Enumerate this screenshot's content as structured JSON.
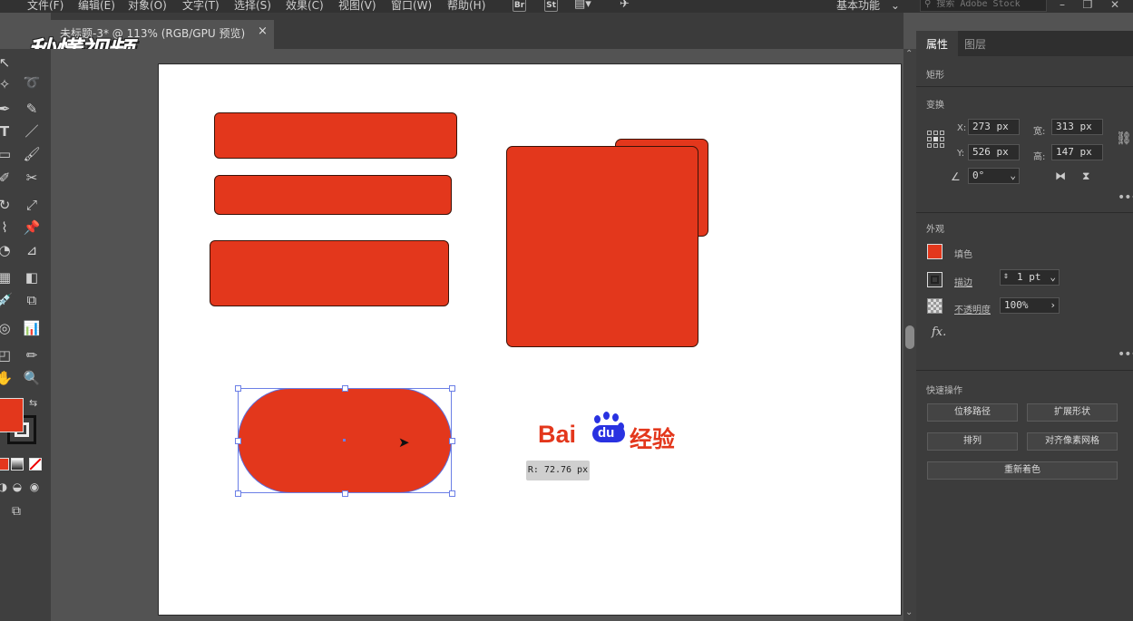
{
  "menubar": {
    "items": [
      "文件(F)",
      "编辑(E)",
      "对象(O)",
      "文字(T)",
      "选择(S)",
      "效果(C)",
      "视图(V)",
      "窗口(W)",
      "帮助(H)"
    ],
    "bridge_label": "Br",
    "stock_label": "St",
    "workspace": "基本功能",
    "search_placeholder": "搜索 Adobe Stock"
  },
  "document_tab": {
    "title": "未标题-3* @ 113% (RGB/GPU 预览)",
    "close": "×"
  },
  "watermark": "秒懂视频",
  "canvas": {
    "radius_tooltip": "R: 72.76 px",
    "logo": {
      "bai": "Bai",
      "du": "du",
      "suffix": "经验"
    }
  },
  "panel": {
    "tabs": [
      "属性",
      "图层"
    ],
    "active_tab": "属性",
    "object_type": "矩形",
    "transform": {
      "title": "变换",
      "x_label": "X:",
      "x": "273 px",
      "y_label": "Y:",
      "y": "526 px",
      "w_label": "宽:",
      "w": "313 px",
      "h_label": "高:",
      "h": "147 px",
      "angle": "0°"
    },
    "appearance": {
      "title": "外观",
      "fill_label": "填色",
      "fill_color": "#e3371c",
      "stroke_label": "描边",
      "stroke_value": "1 pt",
      "opacity_label": "不透明度",
      "opacity_value": "100%",
      "fx": "fx."
    },
    "quick_actions": {
      "title": "快速操作",
      "offset_path": "位移路径",
      "expand_shape": "扩展形状",
      "arrange": "排列",
      "align_pixel": "对齐像素网格",
      "recolor": "重新着色"
    }
  },
  "colors": {
    "shape_fill": "#e3371c",
    "baidu_blue": "#2932e1"
  }
}
